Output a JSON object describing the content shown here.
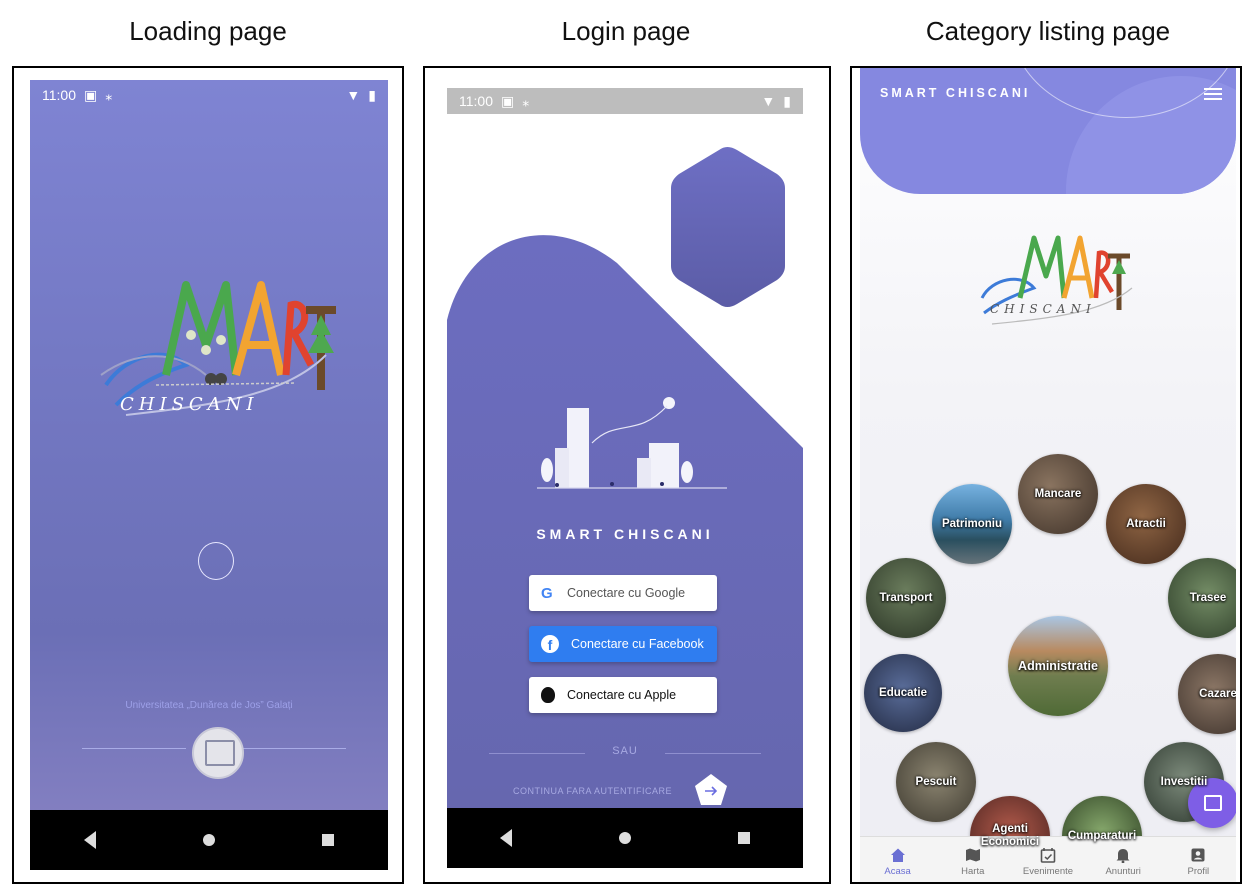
{
  "captions": {
    "loading": "Loading page",
    "login": "Login page",
    "category": "Category listing page"
  },
  "status_bar": {
    "time": "11:00"
  },
  "logo": {
    "word": "SMART",
    "place": "CHISCANI"
  },
  "loading": {
    "university": "Universitatea „Dunărea de Jos” Galați"
  },
  "login": {
    "app_title": "SMART  CHISCANI",
    "google_label": "Conectare cu Google",
    "facebook_label": "Conectare cu Facebook",
    "apple_label": "Conectare cu Apple",
    "or_label": "SAU",
    "continue_label": "CONTINUA FARA AUTENTIFICARE"
  },
  "category": {
    "header_title": "SMART CHISCANI",
    "items": [
      {
        "label": "Mancare",
        "color": "#5a4a3e"
      },
      {
        "label": "Atractii",
        "color": "#6e4a33"
      },
      {
        "label": "Patrimoniu",
        "color": "#3f7ba8"
      },
      {
        "label": "Transport",
        "color": "#3b4d37"
      },
      {
        "label": "Trasee",
        "color": "#47613f"
      },
      {
        "label": "Administratie",
        "color": "#6f7d4f"
      },
      {
        "label": "Educatie",
        "color": "#3c4a6e"
      },
      {
        "label": "Cazare",
        "color": "#5b4b44"
      },
      {
        "label": "Pescuit",
        "color": "#5a5445"
      },
      {
        "label": "Investitii",
        "color": "#4d5a4c"
      },
      {
        "label": "Agenti Economici",
        "color": "#7a3e35"
      },
      {
        "label": "Cumparaturi",
        "color": "#4f6a3f"
      }
    ],
    "nav": [
      {
        "label": "Acasa"
      },
      {
        "label": "Harta"
      },
      {
        "label": "Evenimente"
      },
      {
        "label": "Anunturi"
      },
      {
        "label": "Profil"
      }
    ]
  }
}
